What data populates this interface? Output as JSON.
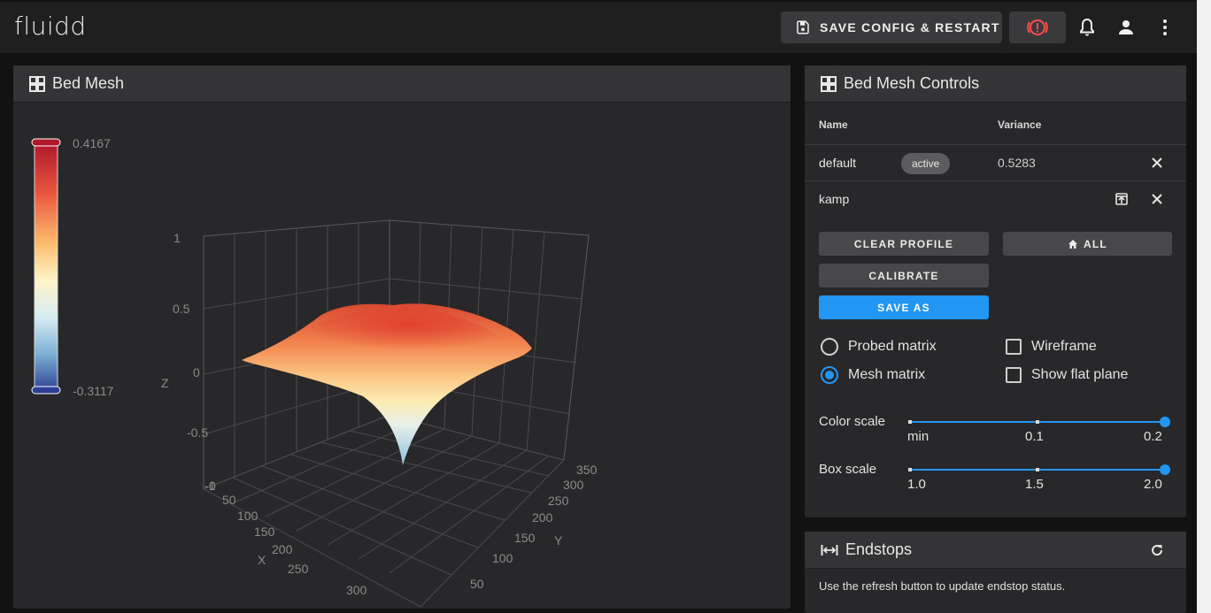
{
  "app": {
    "logo": "fluidd"
  },
  "toolbar": {
    "save_config_label": "SAVE CONFIG & RESTART",
    "estop_icon": "emergency-stop-icon",
    "notifications_icon": "bell-icon",
    "user_icon": "account-icon",
    "menu_icon": "dots-vertical-icon"
  },
  "bed_mesh": {
    "title": "Bed Mesh",
    "colorbar": {
      "max": "0.4167",
      "min": "-0.3117"
    },
    "plot": {
      "z_ticks": [
        "1",
        "0.5",
        "0",
        "-0.5",
        "-1"
      ],
      "z_label": "Z",
      "x_ticks": [
        "0",
        "50",
        "100",
        "150",
        "200",
        "250",
        "300"
      ],
      "x_label": "X",
      "y_ticks": [
        "350",
        "300",
        "250",
        "200",
        "150",
        "100",
        "50"
      ],
      "y_label": "Y"
    }
  },
  "controls": {
    "title": "Bed Mesh Controls",
    "columns": {
      "name": "Name",
      "variance": "Variance"
    },
    "profiles": [
      {
        "name": "default",
        "badge": "active",
        "variance": "0.5283"
      },
      {
        "name": "kamp",
        "badge": "",
        "variance": ""
      }
    ],
    "buttons": {
      "clear_profile": "CLEAR PROFILE",
      "home_all": "ALL",
      "calibrate": "CALIBRATE",
      "save_as": "SAVE AS"
    },
    "options": {
      "probed_matrix": "Probed matrix",
      "mesh_matrix": "Mesh matrix",
      "wireframe": "Wireframe",
      "show_flat_plane": "Show flat plane"
    },
    "color_scale": {
      "label": "Color scale",
      "ticks": [
        "min",
        "0.1",
        "0.2"
      ],
      "value": "0.2"
    },
    "box_scale": {
      "label": "Box scale",
      "ticks": [
        "1.0",
        "1.5",
        "2.0"
      ],
      "value": "2.0"
    }
  },
  "endstops": {
    "title": "Endstops",
    "message": "Use the refresh button to update endstop status."
  }
}
